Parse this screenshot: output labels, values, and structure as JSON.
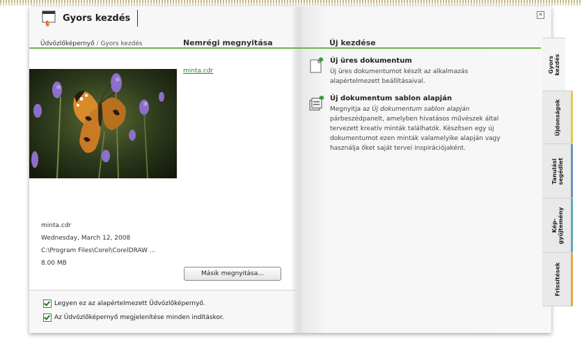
{
  "header": {
    "title": "Gyors kezdés"
  },
  "breadcrumb": {
    "home": "Üdvözlőképernyő",
    "separator": "/",
    "current": "Gyors kezdés"
  },
  "recent": {
    "heading": "Nemrégi megnyitása",
    "file_link": "minta.cdr",
    "open_other_label": "Másik megnyitása..."
  },
  "file_info": {
    "name": "minta.cdr",
    "date": "Wednesday, March 12, 2008",
    "path": "C:\\Program Files\\Corel\\CorelDRAW ...",
    "size": "8.00 MB"
  },
  "new_section": {
    "heading": "Új kezdése",
    "items": [
      {
        "title": "Új üres dokumentum",
        "description": "Új üres dokumentumot készít az alkalmazás alapértelmezett beállításaival."
      },
      {
        "title": "Új dokumentum sablon alapján",
        "desc_prefix": "Megnyitja az ",
        "desc_italic": "Új dokumentum sablon alapján",
        "desc_suffix": " párbeszédpanelt, amelyben hivatásos művészek által tervezett kreatív minták találhatók. Készítsen egy új dokumentumot ezen minták valamelyike alapján vagy használja őket saját tervei inspirációjaként."
      }
    ]
  },
  "checkboxes": [
    {
      "label": "Legyen ez az alapértelmezett Üdvözlőképernyő.",
      "checked": true
    },
    {
      "label": "Az Üdvözlőképernyő megjelenítése minden indításkor.",
      "checked": true
    }
  ],
  "tabs": [
    {
      "line1": "Gyors",
      "line2": "kezdés",
      "color": "#f4f4f4"
    },
    {
      "line1": "Újdonságok",
      "line2": "",
      "color": "#e6c84a"
    },
    {
      "line1": "Tanulási",
      "line2": "segédlet",
      "color": "#6b8fc7"
    },
    {
      "line1": "Kép-",
      "line2": "gyűjtemény",
      "color": "#5aa8c7"
    },
    {
      "line1": "Frissítések",
      "line2": "",
      "color": "#e8a84a"
    }
  ],
  "colors": {
    "accent_green": "#6bb54a",
    "link_green": "#2e7d2e"
  },
  "icons": {
    "header": "corel-quickstart-icon",
    "close": "close-icon",
    "new_blank": "new-document-icon",
    "new_template": "template-document-icon"
  }
}
